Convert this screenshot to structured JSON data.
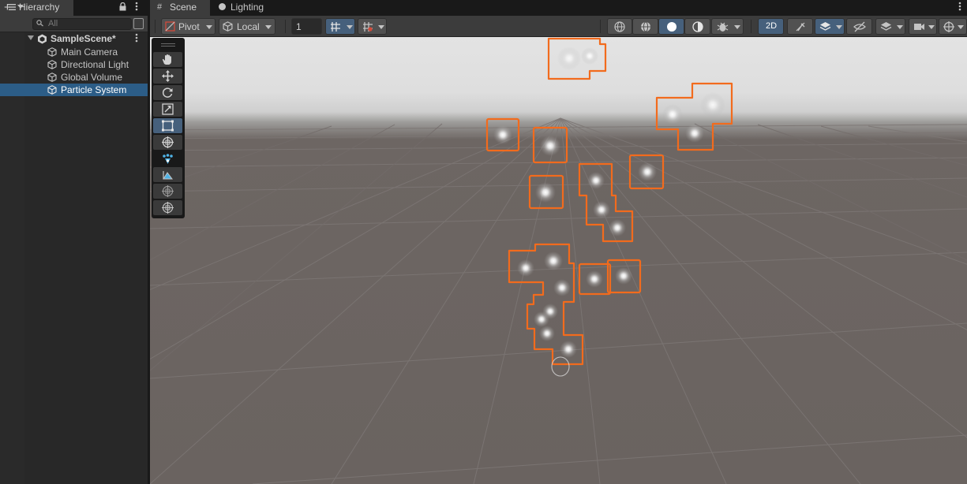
{
  "hierarchy": {
    "tab_label": "Hierarchy",
    "search_placeholder": "All",
    "add_label": "+",
    "scene_name": "SampleScene*",
    "items": [
      {
        "label": "Main Camera"
      },
      {
        "label": "Directional Light"
      },
      {
        "label": "Global Volume"
      },
      {
        "label": "Particle System"
      }
    ],
    "selected_item": "Particle System"
  },
  "scene": {
    "tabs": [
      {
        "label": "Scene"
      },
      {
        "label": "Lighting"
      }
    ],
    "toolbar": {
      "pivot_label": "Pivot",
      "local_label": "Local",
      "grid_snap_value": "1",
      "mode_2d_label": "2D"
    }
  },
  "colors": {
    "accent_blue": "#46607c",
    "selection": "#2c5d87",
    "particle_outline": "#f26b1d"
  }
}
